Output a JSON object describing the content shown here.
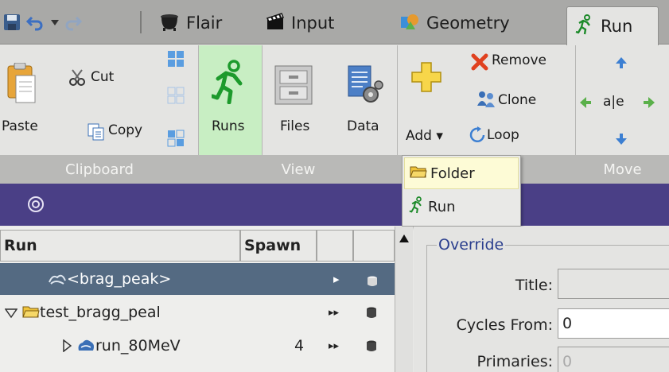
{
  "tabs": [
    {
      "label": "Flair",
      "icon": "cauldron-icon"
    },
    {
      "label": "Input",
      "icon": "clapper-icon"
    },
    {
      "label": "Geometry",
      "icon": "geometry-icon"
    },
    {
      "label": "Run",
      "icon": "runner-icon",
      "active": true
    }
  ],
  "ribbon": {
    "clipboard": {
      "paste": "Paste",
      "cut": "Cut",
      "copy": "Copy",
      "group": "Clipboard"
    },
    "view": {
      "runs": "Runs",
      "files": "Files",
      "data": "Data",
      "group": "View"
    },
    "edit": {
      "remove": "Remove",
      "clone": "Clone",
      "add": "Add ▾",
      "loop": "Loop"
    },
    "move": {
      "center": "a|e",
      "group": "Move"
    }
  },
  "add_menu": {
    "items": [
      "Folder",
      "Run"
    ]
  },
  "tree": {
    "columns": [
      "Run",
      "Spawn"
    ],
    "rows": [
      {
        "label": "<brag_peak>",
        "spawn": "",
        "play": "▸",
        "selected": true
      },
      {
        "label": "test_bragg_peal",
        "spawn": "",
        "play": "▸▸",
        "expanded": true
      },
      {
        "label": "run_80MeV",
        "spawn": "4",
        "play": "▸▸"
      }
    ]
  },
  "override": {
    "title": "Override",
    "fields": [
      {
        "label": "Title:",
        "value": "",
        "disabled": true
      },
      {
        "label": "Cycles From:",
        "value": "0",
        "disabled": false
      },
      {
        "label": "Primaries:",
        "value": "0",
        "disabled": true
      }
    ]
  },
  "colors": {
    "accent_purple": "#4a3f86",
    "selection": "#546a82",
    "view_highlight": "#c8eec3",
    "legend_blue": "#2b3f8e"
  }
}
